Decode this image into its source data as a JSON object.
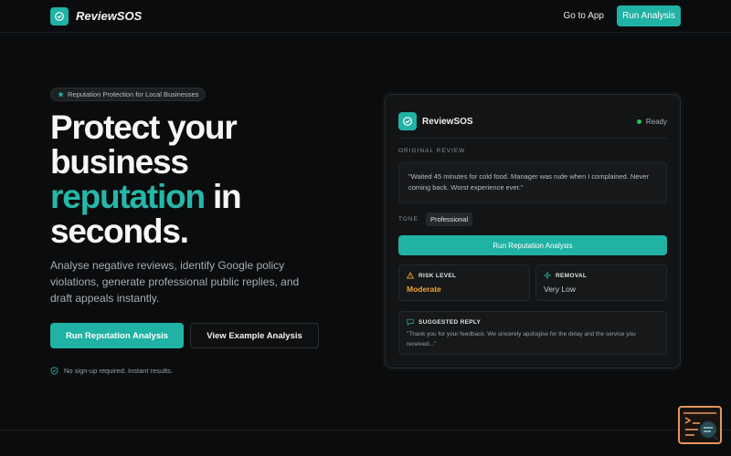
{
  "header": {
    "brand": "ReviewSOS",
    "nav_link": "Go to App",
    "nav_button": "Run Analysis"
  },
  "hero": {
    "badge": "Reputation Protection for Local Businesses",
    "title_line1": "Protect your",
    "title_line2": "business",
    "title_highlight": "reputation",
    "title_in": " in",
    "title_line4": "seconds.",
    "subtitle": "Analyse negative reviews, identify Google policy violations, generate professional public replies, and draft appeals instantly.",
    "primary_cta": "Run Reputation Analysis",
    "secondary_cta": "View Example Analysis",
    "note": "No sign-up required. Instant results."
  },
  "card": {
    "brand": "ReviewSOS",
    "status": "Ready",
    "original_review_label": "ORIGINAL REVIEW",
    "review_text": "\"Waited 45 minutes for cold food. Manager was rude when I complained. Never coming back. Worst experience ever.\"",
    "tone_label": "TONE",
    "tone_value": "Professional",
    "button": "Run Reputation Analysis",
    "risk_label": "RISK LEVEL",
    "risk_value": "Moderate",
    "removal_label": "REMOVAL",
    "removal_value": "Very Low",
    "reply_label": "SUGGESTED REPLY",
    "reply_text": "\"Thank you for your feedback. We sincerely apologise for the delay and the service you received...\""
  },
  "colors": {
    "accent": "#20b2a4",
    "risk": "#f0a53a",
    "status_dot": "#22c55e",
    "background": "#0b0c0d"
  },
  "icons": {
    "logo": "shield-check-icon",
    "badge": "star-icon",
    "note": "shield-check-icon",
    "risk": "warning-triangle-icon",
    "removal": "sparkle-icon",
    "reply": "chat-bubble-icon",
    "widget": "terminal-search-icon"
  }
}
